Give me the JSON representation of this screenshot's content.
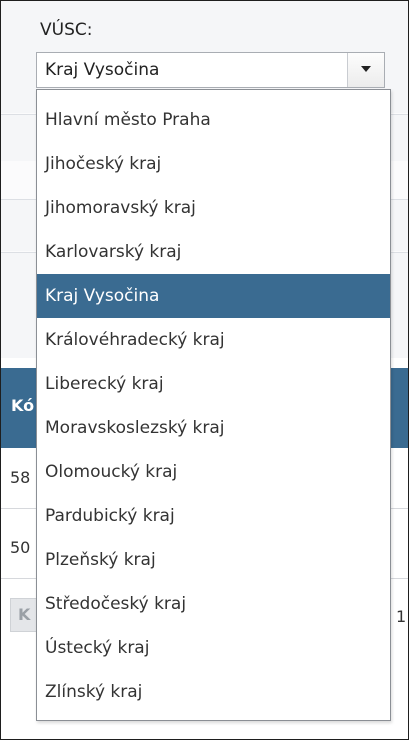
{
  "filter": {
    "label": "VÚSC:",
    "selected_value": "Kraj Vysočina",
    "options": [
      "Hlavní město Praha",
      "Jihočeský kraj",
      "Jihomoravský kraj",
      "Karlovarský kraj",
      "Kraj Vysočina",
      "Královéhradecký kraj",
      "Liberecký kraj",
      "Moravskoslezský kraj",
      "Olomoucký kraj",
      "Pardubický kraj",
      "Plzeňský kraj",
      "Středočeský kraj",
      "Ústecký kraj",
      "Zlínský kraj"
    ]
  },
  "table": {
    "header_fragment": "Kó",
    "row1_fragment": "58",
    "row2_fragment": "50",
    "pager_fragment": "K",
    "right_fragment": "1"
  },
  "colors": {
    "accent": "#3a6b91",
    "panel_bg": "#f5f6f8"
  },
  "icons": {
    "dropdown": "chevron-down-icon"
  }
}
